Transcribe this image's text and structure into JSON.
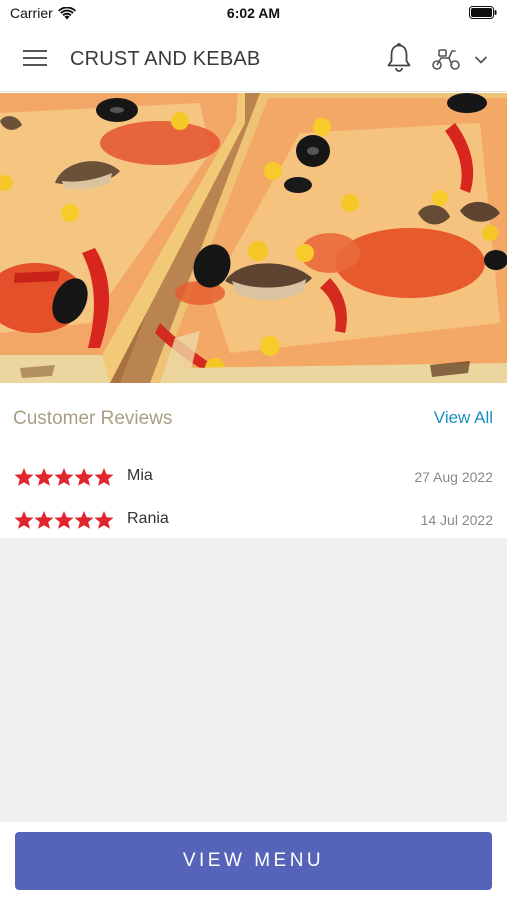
{
  "status_bar": {
    "carrier": "Carrier",
    "time": "6:02 AM"
  },
  "header": {
    "title": "CRUST AND KEBAB",
    "icons": [
      "menu-icon",
      "bell-icon",
      "scooter-icon",
      "chevron-down-icon"
    ]
  },
  "hero": {
    "image": "pizza-photo"
  },
  "reviews": {
    "title": "Customer Reviews",
    "view_all_label": "View All",
    "items": [
      {
        "name": "Mia",
        "date": "27 Aug 2022",
        "rating": 5
      },
      {
        "name": "Rania",
        "date": "14 Jul 2022",
        "rating": 5
      }
    ]
  },
  "footer": {
    "button_label": "VIEW MENU"
  },
  "colors": {
    "accent": "#5564b8",
    "link": "#1a8fc0",
    "star": "#e0252d",
    "section_title": "#a99e86"
  }
}
